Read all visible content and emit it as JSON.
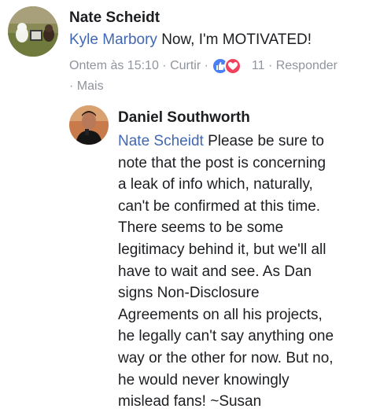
{
  "comments": [
    {
      "author": "Nate Scheidt",
      "mention": "Kyle Marbory",
      "text": "Now, I'm MOTIVATED!",
      "meta": {
        "time": "Ontem às 15:10",
        "like_label": "Curtir",
        "reaction_count": "11",
        "reply_label": "Responder",
        "more_label": "Mais",
        "separator": "·"
      }
    },
    {
      "author": "Daniel Southworth",
      "mention": "Nate Scheidt",
      "lines": [
        " Please be sure to",
        "note that the post is concerning",
        "a leak of info which, naturally,",
        "can't be confirmed at this time.",
        "There seems to be some",
        "legitimacy behind it, but we'll all",
        "have to wait and see. As Dan",
        "signs Non-Disclosure",
        "Agreements on all his projects,",
        "he legally can't say anything one",
        "way or the other for now. But no,",
        "he would never knowingly",
        "mislead fans! ~Susan"
      ]
    }
  ],
  "icons": {
    "like": "thumbs-up-icon",
    "love": "heart-icon"
  },
  "colors": {
    "mention": "#4267b2",
    "meta": "#90949c",
    "like": "#4a80f5",
    "love": "#f0415e"
  }
}
